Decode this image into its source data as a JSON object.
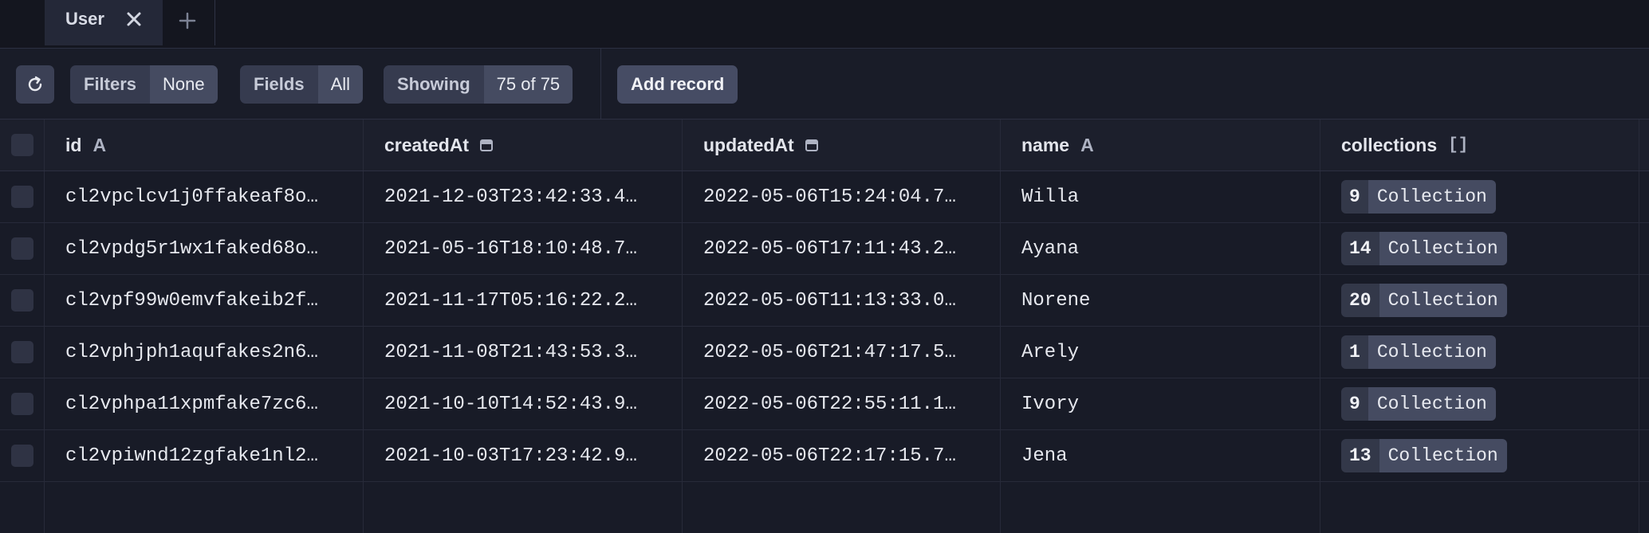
{
  "tabs": [
    {
      "label": "User"
    }
  ],
  "toolbar": {
    "filters": {
      "label": "Filters",
      "value": "None"
    },
    "fields": {
      "label": "Fields",
      "value": "All"
    },
    "showing": {
      "label": "Showing",
      "value": "75 of 75"
    },
    "add_record": "Add record"
  },
  "table": {
    "columns": [
      {
        "name": "id",
        "type_glyph": "A"
      },
      {
        "name": "createdAt",
        "type_glyph": "calendar"
      },
      {
        "name": "updatedAt",
        "type_glyph": "calendar"
      },
      {
        "name": "name",
        "type_glyph": "A"
      },
      {
        "name": "collections",
        "type_glyph": "[]"
      }
    ],
    "rows": [
      {
        "id": "cl2vpclcv1j0ffakeaf8o…",
        "createdAt": "2021-12-03T23:42:33.4…",
        "updatedAt": "2022-05-06T15:24:04.7…",
        "name": "Willa",
        "collections_count": "9",
        "collections_label": "Collection"
      },
      {
        "id": "cl2vpdg5r1wx1faked68o…",
        "createdAt": "2021-05-16T18:10:48.7…",
        "updatedAt": "2022-05-06T17:11:43.2…",
        "name": "Ayana",
        "collections_count": "14",
        "collections_label": "Collection"
      },
      {
        "id": "cl2vpf99w0emvfakeib2f…",
        "createdAt": "2021-11-17T05:16:22.2…",
        "updatedAt": "2022-05-06T11:13:33.0…",
        "name": "Norene",
        "collections_count": "20",
        "collections_label": "Collection"
      },
      {
        "id": "cl2vphjph1aqufakes2n6…",
        "createdAt": "2021-11-08T21:43:53.3…",
        "updatedAt": "2022-05-06T21:47:17.5…",
        "name": "Arely",
        "collections_count": "1",
        "collections_label": "Collection"
      },
      {
        "id": "cl2vphpa11xpmfake7zc6…",
        "createdAt": "2021-10-10T14:52:43.9…",
        "updatedAt": "2022-05-06T22:55:11.1…",
        "name": "Ivory",
        "collections_count": "9",
        "collections_label": "Collection"
      },
      {
        "id": "cl2vpiwnd12zgfake1nl2…",
        "createdAt": "2021-10-03T17:23:42.9…",
        "updatedAt": "2022-05-06T22:17:15.7…",
        "name": "Jena",
        "collections_count": "13",
        "collections_label": "Collection"
      }
    ]
  },
  "icons": {
    "tab_close": "close-icon",
    "tab_add": "plus-icon",
    "refresh": "refresh-icon",
    "calendar": "calendar-icon",
    "string_type": "letter-a-icon",
    "list_type": "brackets-icon"
  }
}
